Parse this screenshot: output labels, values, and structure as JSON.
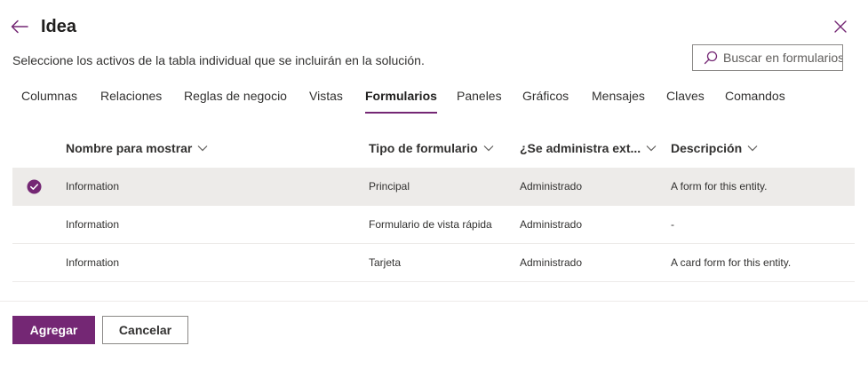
{
  "header": {
    "title": "Idea",
    "subtitle": "Seleccione los activos de la tabla individual que se incluirán en la solución.",
    "back_icon": "arrow-left-icon",
    "close_icon": "close-icon"
  },
  "search": {
    "placeholder": "Buscar en formularios",
    "value": "",
    "icon": "search-icon"
  },
  "tabs": [
    {
      "label": "Columnas",
      "active": false
    },
    {
      "label": "Relaciones",
      "active": false
    },
    {
      "label": "Reglas de negocio",
      "active": false
    },
    {
      "label": "Vistas",
      "active": false
    },
    {
      "label": "Formularios",
      "active": true
    },
    {
      "label": "Paneles",
      "active": false
    },
    {
      "label": "Gráficos",
      "active": false
    },
    {
      "label": "Mensajes",
      "active": false
    },
    {
      "label": "Claves",
      "active": false
    },
    {
      "label": "Comandos",
      "active": false
    }
  ],
  "grid": {
    "columns": [
      {
        "label": "Nombre para mostrar"
      },
      {
        "label": "Tipo de formulario"
      },
      {
        "label": "¿Se administra ext..."
      },
      {
        "label": "Descripción"
      }
    ],
    "rows": [
      {
        "selected": true,
        "name": "Information",
        "type": "Principal",
        "managed": "Administrado",
        "description": "A form for this entity."
      },
      {
        "selected": false,
        "name": "Information",
        "type": "Formulario de vista rápida",
        "managed": "Administrado",
        "description": "-"
      },
      {
        "selected": false,
        "name": "Information",
        "type": "Tarjeta",
        "managed": "Administrado",
        "description": "A card form for this entity."
      }
    ]
  },
  "footer": {
    "add_label": "Agregar",
    "cancel_label": "Cancelar"
  },
  "colors": {
    "accent": "#742774",
    "selected_row": "#edebe9",
    "text": "#323130"
  }
}
